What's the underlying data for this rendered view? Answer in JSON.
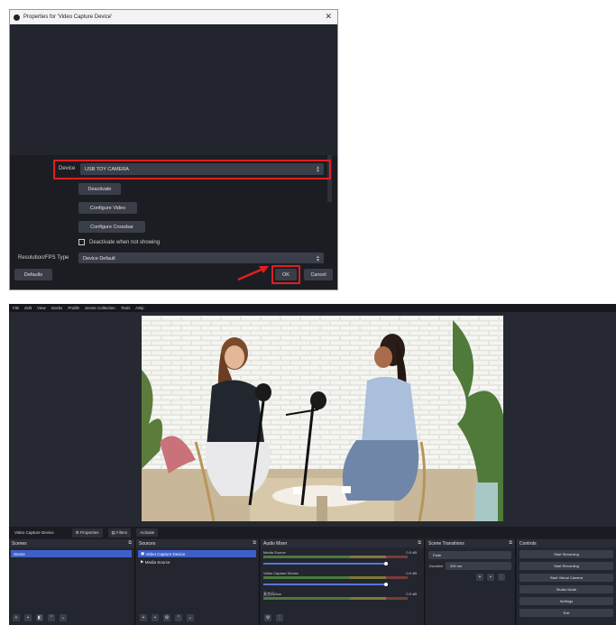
{
  "dialog": {
    "title": "Properties for 'Video Capture Device'",
    "close_glyph": "✕",
    "device_label": "Device",
    "device_value": "USB TOY CAMERA",
    "deactivate_label": "Deactivate",
    "configure_video_label": "Configure Video",
    "configure_crossbar_label": "Configure Crossbar",
    "deactivate_when_not_showing_label": "Deactivate when not showing",
    "resolution_label": "Resolution/FPS Type",
    "resolution_value": "Device Default",
    "defaults_label": "Defaults",
    "ok_label": "OK",
    "cancel_label": "Cancel",
    "highlight_color": "#e01f1f"
  },
  "obs": {
    "menu": [
      "File",
      "Edit",
      "View",
      "Docks",
      "Profile",
      "Scene Collection",
      "Tools",
      "Help"
    ],
    "source_toolbar": {
      "source_name": "Video Capture Device",
      "properties_label": "Properties",
      "filters_label": "Filters",
      "activate_label": "Activate"
    },
    "scenes": {
      "header": "Scenes",
      "items": [
        "Scene"
      ]
    },
    "sources": {
      "header": "Sources",
      "items": [
        "Video Capture Device",
        "Media Source"
      ]
    },
    "mixer": {
      "header": "Audio Mixer",
      "channels": [
        {
          "name": "Media Source",
          "db": "0.0 dB"
        },
        {
          "name": "Video Capture Device",
          "db": "0.0 dB"
        },
        {
          "name": "麦克风/Aux",
          "db": "0.0 dB"
        }
      ]
    },
    "transitions": {
      "header": "Scene Transitions",
      "type_value": "Fade",
      "duration_label": "Duration",
      "duration_value": "300 ms"
    },
    "controls": {
      "header": "Controls",
      "buttons": [
        "Start Streaming",
        "Start Recording",
        "Start Virtual Camera",
        "Studio Mode",
        "Settings",
        "Exit"
      ]
    },
    "accent_color": "#3d5fc9"
  }
}
